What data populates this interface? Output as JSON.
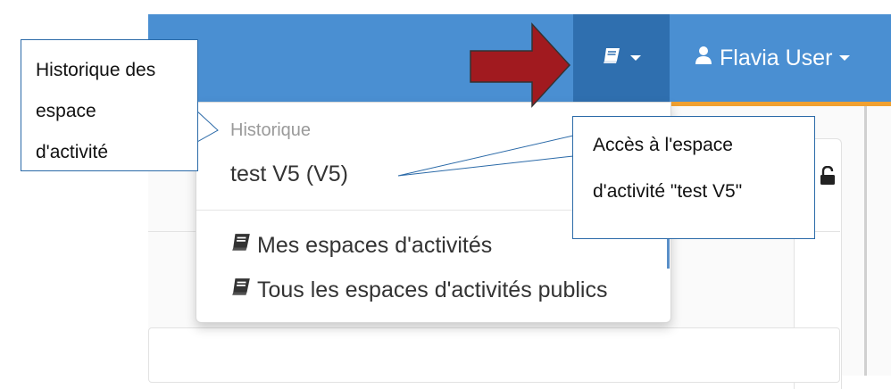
{
  "navbar": {
    "book_menu_icon": "book-icon",
    "user_icon": "user-icon",
    "user_label": "Flavia User",
    "colors": {
      "bar": "#4a8fd2",
      "active": "#2f6faf",
      "accent": "#f0a030"
    }
  },
  "dropdown": {
    "header": "Historique",
    "recent_items": [
      {
        "label": "test V5 (V5)"
      }
    ],
    "items": [
      {
        "icon": "book-icon",
        "label": "Mes espaces d'activités"
      },
      {
        "icon": "book-icon",
        "label": "Tous les espaces d'activités publics"
      }
    ]
  },
  "annotations": {
    "left": {
      "lines": [
        "Historique des",
        "espace",
        "d'activité"
      ]
    },
    "right": {
      "lines": [
        "Accès à l'espace",
        "d'activité \"test V5\""
      ]
    },
    "arrow_color": "#a11a1f"
  },
  "page": {
    "lock_icon": "unlock-icon"
  }
}
